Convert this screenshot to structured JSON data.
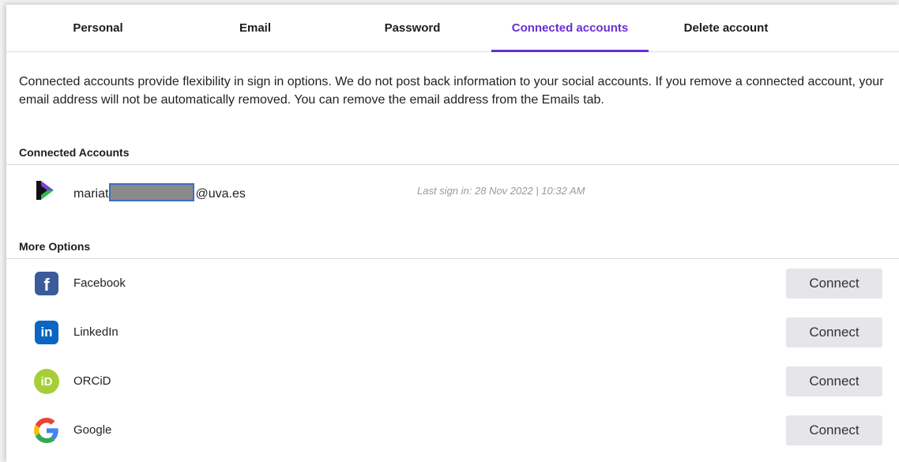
{
  "tabs": [
    {
      "label": "Personal"
    },
    {
      "label": "Email"
    },
    {
      "label": "Password"
    },
    {
      "label": "Connected accounts"
    },
    {
      "label": "Delete account"
    }
  ],
  "description": "Connected accounts provide flexibility in sign in options. We do not post back information to your social accounts. If you remove a connected account, your email address will not be automatically removed. You can remove the email address from the Emails tab.",
  "connected": {
    "title": "Connected Accounts",
    "email_prefix": "mariat",
    "email_suffix": "@uva.es",
    "last_sign_in": "Last sign in: 28 Nov 2022 | 10:32 AM"
  },
  "more_options": {
    "title": "More Options",
    "items": [
      {
        "label": "Facebook",
        "icon": "facebook-icon",
        "button": "Connect"
      },
      {
        "label": "LinkedIn",
        "icon": "linkedin-icon",
        "button": "Connect"
      },
      {
        "label": "ORCiD",
        "icon": "orcid-icon",
        "button": "Connect"
      },
      {
        "label": "Google",
        "icon": "google-icon",
        "button": "Connect"
      }
    ]
  },
  "colors": {
    "accent": "#6a2fd1",
    "button_bg": "#e6e6ea",
    "facebook": "#3b5b9a",
    "linkedin": "#0a66c2",
    "orcid": "#a6ce39"
  }
}
